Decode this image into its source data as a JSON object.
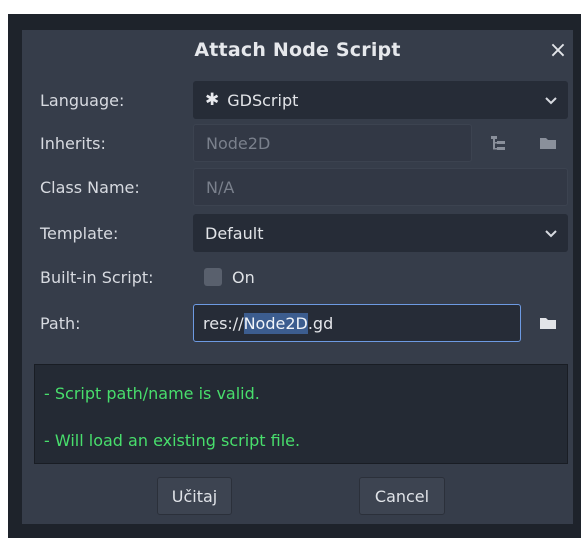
{
  "dialog": {
    "title": "Attach Node Script",
    "close_icon": "×"
  },
  "form": {
    "language": {
      "label": "Language:",
      "value": "GDScript",
      "icon": "gear-icon"
    },
    "inherits": {
      "label": "Inherits:",
      "value": "Node2D"
    },
    "class_name": {
      "label": "Class Name:",
      "value": "N/A"
    },
    "template": {
      "label": "Template:",
      "value": "Default"
    },
    "builtin": {
      "label": "Built-in Script:",
      "checkbox_label": "On",
      "checked": false
    },
    "path": {
      "label": "Path:",
      "prefix": "res://",
      "selected": "Node2D",
      "suffix": ".gd"
    }
  },
  "status": {
    "line1": "- Script path/name is valid.",
    "line2": "- Will load an existing script file.",
    "color": "#48de6c"
  },
  "buttons": {
    "ok": "Učitaj",
    "cancel": "Cancel"
  },
  "colors": {
    "panel": "#363d4a",
    "field": "#262c37",
    "accent": "#6d9ae2"
  }
}
